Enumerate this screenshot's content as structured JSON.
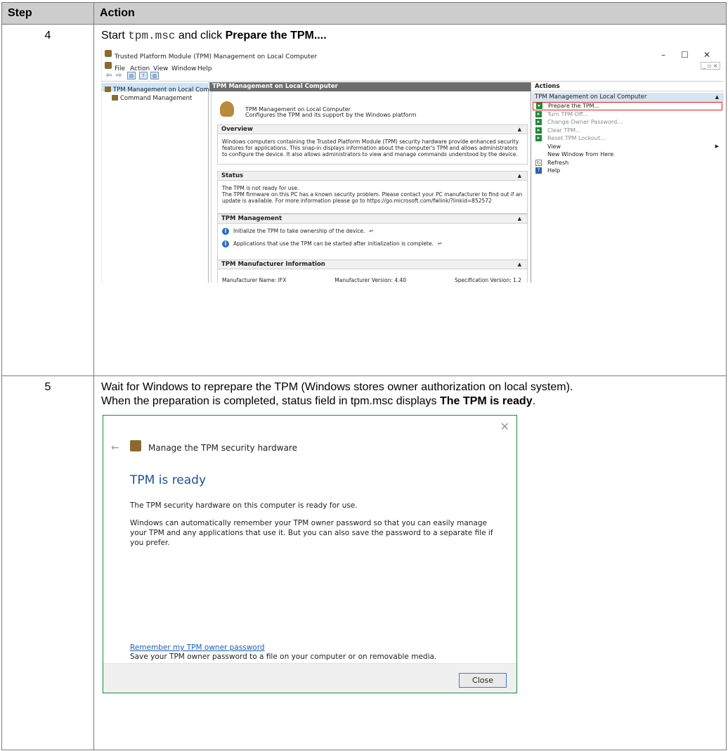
{
  "table": {
    "headers": {
      "step": "Step",
      "action": "Action"
    },
    "rows": [
      {
        "step": "4",
        "text_before": "Start ",
        "command": "tpm.msc",
        "text_middle": " and click ",
        "action_bold": "Prepare the TPM...."
      },
      {
        "step": "5",
        "line1": "Wait for Windows to reprepare the TPM (Windows stores owner authorization on local system).",
        "line2_before": "When the preparation is completed, status field in tpm.msc displays ",
        "line2_bold": "The TPM is ready",
        "line2_after": "."
      }
    ]
  },
  "mmc": {
    "title": "Trusted Platform Module (TPM) Management on Local Computer",
    "window_buttons": [
      "–",
      "☐",
      "✕"
    ],
    "menu": [
      "File",
      "Action",
      "View",
      "Window",
      "Help"
    ],
    "mini_buttons": "_ ▫ ×",
    "tree": [
      "TPM Management on Local Comp",
      "Command Management"
    ],
    "center_header": "TPM Management on Local Computer",
    "intro_title": "TPM Management on Local Computer",
    "intro_sub": "Configures the TPM and its support by the Windows platform",
    "overview_title": "Overview",
    "overview_text": "Windows computers containing the Trusted Platform Module (TPM) security hardware provide enhanced security features for applications. This snap-in displays information about the computer's TPM and allows administrators to configure the device. It also allows administrators to view and manage commands understood by the device.",
    "status_title": "Status",
    "status_line1": "The TPM is not ready for use.",
    "status_line2": "The TPM firmware on this PC has a known security problem. Please contact your PC manufacturer to find out if an update is available. For more information please go to https://go.microsoft.com/fwlink/?linkid=852572",
    "mgmt_title": "TPM Management",
    "mgmt_item1": "Initialize the TPM to take ownership of the device.",
    "mgmt_item2": "Applications that use the TPM can be started after initialization is complete.",
    "mfr_title": "TPM Manufacturer Information",
    "mfr_name": "Manufacturer Name:  IFX",
    "mfr_version": "Manufacturer Version:  4.40",
    "spec_version": "Specification Version:  1.2",
    "actions_header": "Actions",
    "actions_sub": "TPM Management on Local Computer",
    "actions": [
      "Prepare the TPM...",
      "Turn TPM Off...",
      "Change Owner Password...",
      "Clear TPM...",
      "Reset TPM Lockout...",
      "View",
      "New Window from Here",
      "Refresh",
      "Help"
    ]
  },
  "dialog": {
    "title": "Manage the TPM security hardware",
    "heading": "TPM is ready",
    "para1": "The TPM security hardware on this computer is ready for use.",
    "para2": "Windows can automatically remember your TPM owner password so that you can easily manage your TPM and any applications that use it. But you can also save the password to a separate file if you prefer.",
    "link": "Remember my TPM owner password",
    "note": "Save your TPM owner password to a file on your computer or on removable media.",
    "close_button": "Close"
  },
  "colors": {
    "header_bg": "#cdcdcd",
    "highlight_outline": "#e0201e",
    "dialog_border": "#1e8a3a",
    "dialog_heading": "#1f4f99",
    "link": "#1a5fb4"
  }
}
